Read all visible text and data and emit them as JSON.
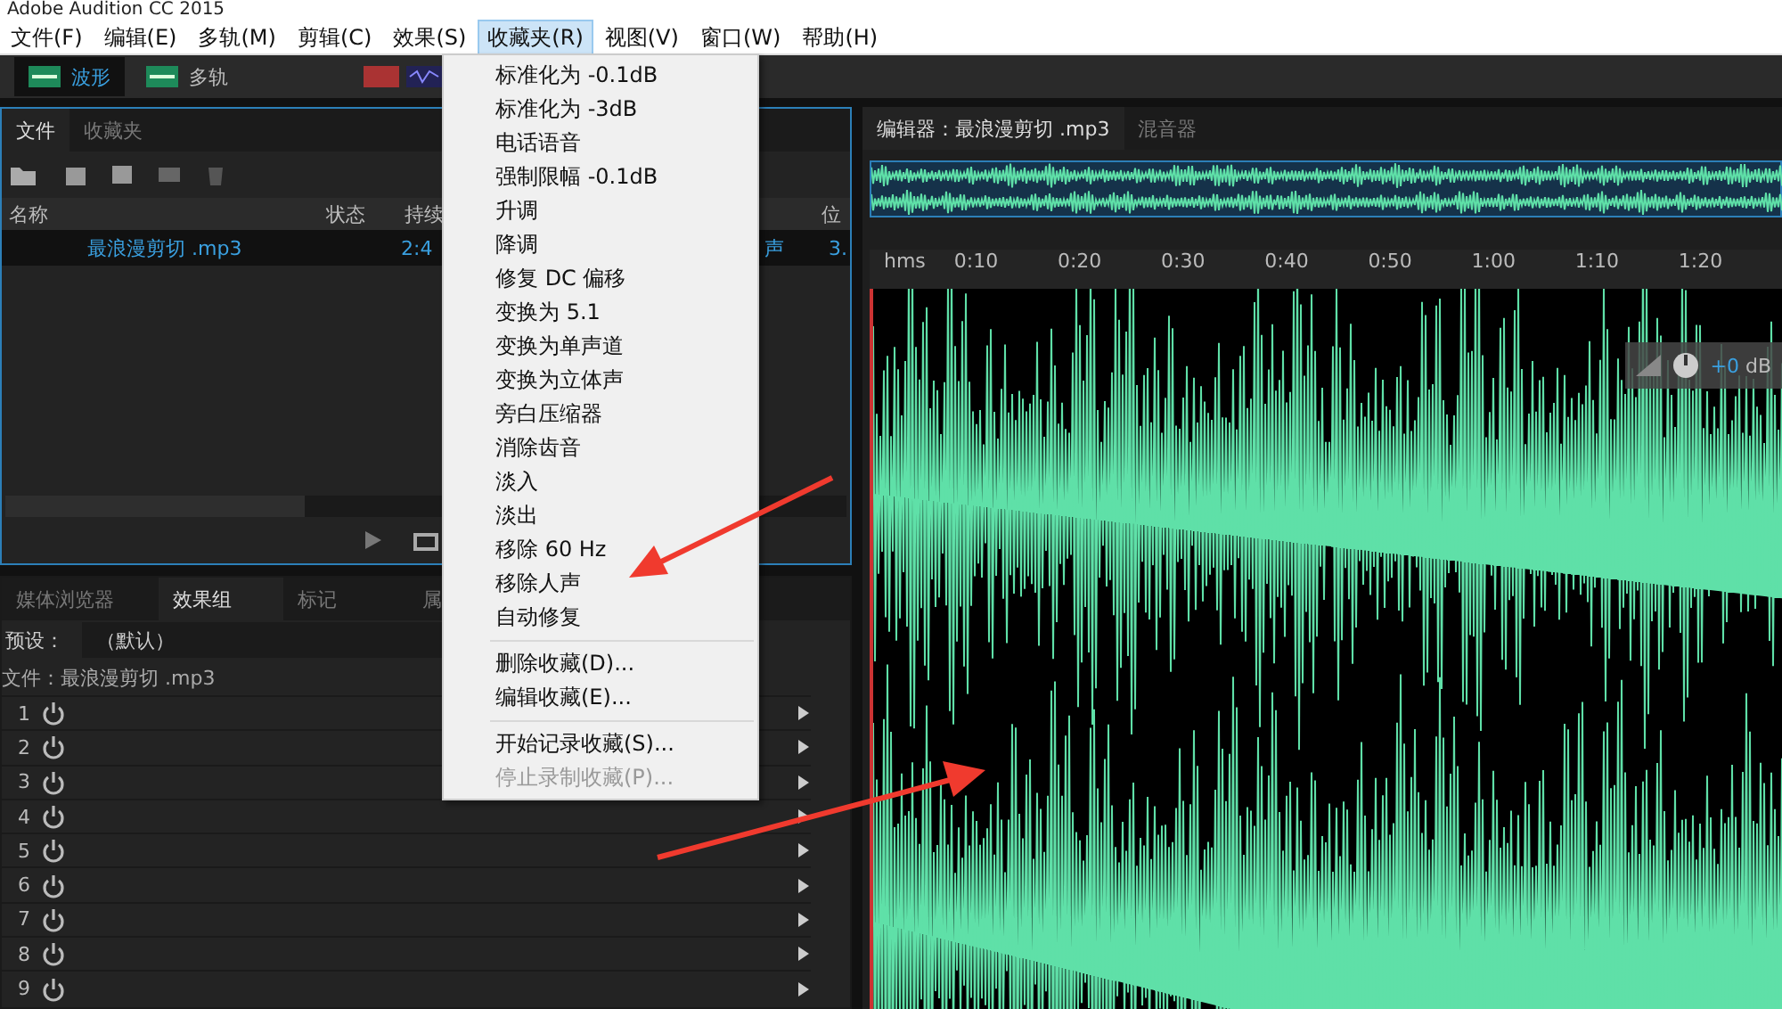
{
  "window": {
    "title": "Adobe Audition CC 2015"
  },
  "menu_bar": [
    {
      "label": "文件(F)",
      "selected": false
    },
    {
      "label": "编辑(E)",
      "selected": false
    },
    {
      "label": "多轨(M)",
      "selected": false
    },
    {
      "label": "剪辑(C)",
      "selected": false
    },
    {
      "label": "效果(S)",
      "selected": false
    },
    {
      "label": "收藏夹(R)",
      "selected": true
    },
    {
      "label": "视图(V)",
      "selected": false
    },
    {
      "label": "窗口(W)",
      "selected": false
    },
    {
      "label": "帮助(H)",
      "selected": false
    }
  ],
  "toolbar": {
    "modes": [
      {
        "label": "波形",
        "selected": true
      },
      {
        "label": "多轨",
        "selected": false
      }
    ]
  },
  "favorites_menu": [
    {
      "label": "标准化为 -0.1dB",
      "kind": "item",
      "disabled": false
    },
    {
      "label": "标准化为 -3dB",
      "kind": "item",
      "disabled": false
    },
    {
      "label": "电话语音",
      "kind": "item",
      "disabled": false
    },
    {
      "label": "强制限幅 -0.1dB",
      "kind": "item",
      "disabled": false
    },
    {
      "label": "升调",
      "kind": "item",
      "disabled": false
    },
    {
      "label": "降调",
      "kind": "item",
      "disabled": false
    },
    {
      "label": "修复 DC 偏移",
      "kind": "item",
      "disabled": false
    },
    {
      "label": "变换为 5.1",
      "kind": "item",
      "disabled": false
    },
    {
      "label": "变换为单声道",
      "kind": "item",
      "disabled": false
    },
    {
      "label": "变换为立体声",
      "kind": "item",
      "disabled": false
    },
    {
      "label": "旁白压缩器",
      "kind": "item",
      "disabled": false
    },
    {
      "label": "消除齿音",
      "kind": "item",
      "disabled": false
    },
    {
      "label": "淡入",
      "kind": "item",
      "disabled": false
    },
    {
      "label": "淡出",
      "kind": "item",
      "disabled": false
    },
    {
      "label": "移除 60 Hz",
      "kind": "item",
      "disabled": false
    },
    {
      "label": "移除人声",
      "kind": "item",
      "disabled": false
    },
    {
      "label": "自动修复",
      "kind": "item",
      "disabled": false
    },
    {
      "kind": "separator"
    },
    {
      "label": "删除收藏(D)...",
      "kind": "item",
      "disabled": false
    },
    {
      "label": "编辑收藏(E)...",
      "kind": "item",
      "disabled": false
    },
    {
      "kind": "separator"
    },
    {
      "label": "开始记录收藏(S)...",
      "kind": "item",
      "disabled": false
    },
    {
      "label": "停止录制收藏(P)...",
      "kind": "item",
      "disabled": true
    }
  ],
  "files_panel": {
    "tabs": [
      {
        "label": "文件",
        "selected": true
      },
      {
        "label": "收藏夹",
        "selected": false
      }
    ],
    "columns": [
      "名称",
      "状态",
      "持续",
      "位"
    ],
    "rows": [
      {
        "name": "最浪漫剪切 .mp3",
        "column_3": "2:4",
        "column_4": "声",
        "column_5": "3.",
        "selected": true
      }
    ]
  },
  "effects_panel": {
    "tabs": [
      {
        "label": "媒体浏览器",
        "selected": false
      },
      {
        "label": "效果组",
        "selected": true
      },
      {
        "label": "标记",
        "selected": false
      },
      {
        "label": "属",
        "selected": false
      }
    ],
    "preset_label": "预设：",
    "preset_value": "（默认）",
    "file_label": "文件：最浪漫剪切 .mp3",
    "slots": [
      {
        "number": "1",
        "on": false
      },
      {
        "number": "2",
        "on": false
      },
      {
        "number": "3",
        "on": false
      },
      {
        "number": "4",
        "on": false
      },
      {
        "number": "5",
        "on": false
      },
      {
        "number": "6",
        "on": false
      },
      {
        "number": "7",
        "on": false
      },
      {
        "number": "8",
        "on": false
      },
      {
        "number": "9",
        "on": false
      }
    ]
  },
  "editor": {
    "tabs": [
      {
        "label": "编辑器：最浪漫剪切 .mp3",
        "selected": true
      },
      {
        "label": "混音器",
        "selected": false
      }
    ],
    "ruler": [
      "hms",
      "0:10",
      "0:20",
      "0:30",
      "0:40",
      "0:50",
      "1:00",
      "1:10",
      "1:20"
    ],
    "gain": {
      "value": "+0",
      "unit": "dB"
    }
  }
}
